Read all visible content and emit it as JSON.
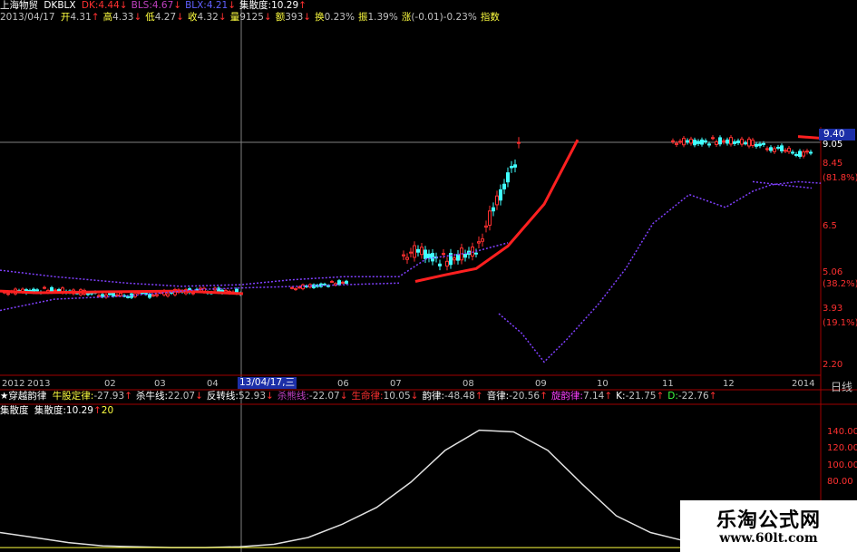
{
  "stock_name": "上海物贸",
  "header1": {
    "indicator": "DKBLX",
    "items": [
      {
        "label": "DK:4.44",
        "arrow": "↓",
        "color": "#ff3030"
      },
      {
        "label": "BLS:4.67",
        "arrow": "↓",
        "color": "#c040c0"
      },
      {
        "label": "BLX:4.21",
        "arrow": "↓",
        "color": "#6060ff"
      },
      {
        "label": "集散度:10.29",
        "arrow": "↑",
        "color": "#ffffff"
      }
    ]
  },
  "header2": {
    "date": "2013/04/17",
    "items": [
      {
        "label": "开",
        "value": "4.31",
        "arrow": "↑"
      },
      {
        "label": "高",
        "value": "4.33",
        "arrow": "↓"
      },
      {
        "label": "低",
        "value": "4.27",
        "arrow": "↓"
      },
      {
        "label": "收",
        "value": "4.32",
        "arrow": "↓"
      },
      {
        "label": "量",
        "value": "9125",
        "arrow": "↓"
      },
      {
        "label": "额",
        "value": "393",
        "arrow": "↓"
      },
      {
        "label": "换",
        "value": "0.23%",
        "arrow": ""
      },
      {
        "label": "振",
        "value": "1.39%",
        "arrow": ""
      },
      {
        "label": "涨",
        "value": "(-0.01)-0.23%",
        "arrow": ""
      },
      {
        "label": "指数",
        "value": "",
        "arrow": ""
      }
    ]
  },
  "price_axis": {
    "labels": [
      {
        "text": "9.40",
        "price": 9.4,
        "color": "#ffffff"
      },
      {
        "text": "9.05",
        "price": 9.05,
        "color": "#ffffff"
      },
      {
        "text": "8.45",
        "price": 8.45,
        "color": "#ff3030"
      },
      {
        "text": "(81.8%)",
        "price": 8.0,
        "color": "#ff3030"
      },
      {
        "text": "6.5",
        "price": 6.5,
        "color": "#ff3030"
      },
      {
        "text": "5.06",
        "price": 5.06,
        "color": "#ff3030"
      },
      {
        "text": "(38.2%)",
        "price": 4.7,
        "color": "#ff3030"
      },
      {
        "text": "3.93",
        "price": 3.93,
        "color": "#ff3030"
      },
      {
        "text": "(19.1%)",
        "price": 3.5,
        "color": "#ff3030"
      },
      {
        "text": "2.20",
        "price": 2.2,
        "color": "#ff3030"
      }
    ],
    "range": [
      2.0,
      9.6
    ]
  },
  "current_price_tag": "9.40",
  "cursor_date_tag": "13/04/17,三",
  "period_label": "日线",
  "x_axis_labels": [
    "2012",
    "2013",
    "02",
    "03",
    "04",
    "06",
    "07",
    "08",
    "09",
    "10",
    "11",
    "12",
    "2014"
  ],
  "indicator_row": {
    "title": "★穿越韵律",
    "items": [
      {
        "label": "牛股定律:",
        "value": "-27.93",
        "arrow": "↑",
        "color": "#ffff40"
      },
      {
        "label": "杀牛线:",
        "value": "22.07",
        "arrow": "↓",
        "color": "#ffffff"
      },
      {
        "label": "反转线:",
        "value": "52.93",
        "arrow": "↓",
        "color": "#ffffff"
      },
      {
        "label": "杀熊线:",
        "value": "-22.07",
        "arrow": "↓",
        "color": "#c040c0"
      },
      {
        "label": "生命律:",
        "value": "10.05",
        "arrow": "↓",
        "color": "#ff3030"
      },
      {
        "label": "韵律:",
        "value": "-48.48",
        "arrow": "↑",
        "color": "#ffffff"
      },
      {
        "label": "音律:",
        "value": "-20.56",
        "arrow": "↑",
        "color": "#ffffff"
      },
      {
        "label": "旋韵律:",
        "value": "7.14",
        "arrow": "↑",
        "color": "#ff40ff"
      },
      {
        "label": "K:",
        "value": "-21.75",
        "arrow": "↑",
        "color": "#ffffff"
      },
      {
        "label": "D:",
        "value": "-22.76",
        "arrow": "↑",
        "color": "#40ff40"
      }
    ]
  },
  "sub_row": {
    "title": "集散度",
    "label": "集散度:",
    "value": "10.29",
    "arrow": "↑",
    "extra": "20"
  },
  "sub_axis": {
    "labels": [
      "140.00",
      "120.00",
      "100.00",
      "80.00"
    ],
    "range": [
      0,
      160
    ]
  },
  "watermark": {
    "title": "乐淘公式网",
    "url": "www.60lt.com"
  },
  "colors": {
    "background": "#000000",
    "up": "#ff3030",
    "down": "#40ffff",
    "ma_line": "#ff2020",
    "band_line": "#8040ff",
    "sub_line": "#e0e0e0",
    "grid_red": "#a00000"
  },
  "chart_data": {
    "type": "line",
    "series": [
      {
        "name": "集散度",
        "x": [
          0,
          1,
          2,
          3,
          4,
          5,
          6,
          7,
          8,
          9,
          10,
          11,
          12,
          13,
          14,
          15,
          16,
          17,
          18,
          19,
          20
        ],
        "values": [
          20,
          14,
          8,
          4,
          3,
          2,
          2,
          3,
          6,
          14,
          30,
          50,
          80,
          118,
          142,
          140,
          118,
          78,
          40,
          20,
          10
        ]
      }
    ],
    "ylim": [
      0,
      160
    ]
  }
}
